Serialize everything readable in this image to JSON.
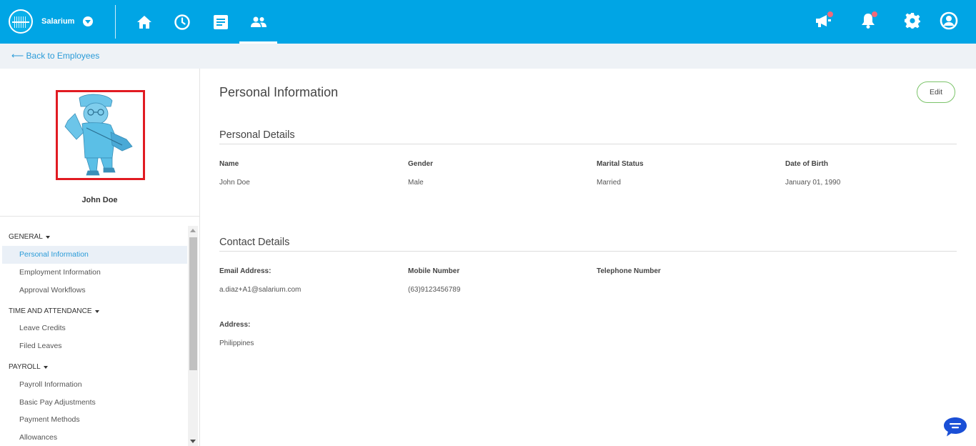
{
  "app": {
    "name": "Salarium"
  },
  "nav": {
    "icons": [
      "home-icon",
      "clock-icon",
      "document-icon",
      "people-icon"
    ],
    "active": "people-icon",
    "right_icons": [
      "megaphone-icon",
      "bell-icon",
      "gear-icon",
      "user-circle-icon"
    ]
  },
  "subbar": {
    "back_label": "⟵ Back to Employees"
  },
  "employee": {
    "name": "John Doe"
  },
  "sidebar": {
    "groups": [
      {
        "label": "GENERAL",
        "items": [
          "Personal Information",
          "Employment Information",
          "Approval Workflows"
        ]
      },
      {
        "label": "TIME AND ATTENDANCE",
        "items": [
          "Leave Credits",
          "Filed Leaves"
        ]
      },
      {
        "label": "PAYROLL",
        "items": [
          "Payroll Information",
          "Basic Pay Adjustments",
          "Payment Methods",
          "Allowances"
        ]
      }
    ],
    "active_item": "Personal Information"
  },
  "main": {
    "title": "Personal Information",
    "edit_label": "Edit",
    "personal_details": {
      "title": "Personal Details",
      "fields": [
        {
          "label": "Name",
          "value": "John Doe"
        },
        {
          "label": "Gender",
          "value": "Male"
        },
        {
          "label": "Marital Status",
          "value": "Married"
        },
        {
          "label": "Date of Birth",
          "value": "January 01, 1990"
        }
      ]
    },
    "contact_details": {
      "title": "Contact Details",
      "fields": [
        {
          "label": "Email Address:",
          "value": "a.diaz+A1@salarium.com"
        },
        {
          "label": "Mobile Number",
          "value": "(63)9123456789"
        },
        {
          "label": "Telephone Number",
          "value": ""
        }
      ],
      "address": {
        "label": "Address:",
        "value": "Philippines"
      }
    }
  },
  "colors": {
    "topbar": "#00a5e5",
    "accent_link": "#2a9bd8",
    "edit_border": "#7cc46a",
    "avatar_frame": "#e11b22",
    "notification_dot": "#f16a7a",
    "chat_bubble": "#1a4fd6"
  }
}
